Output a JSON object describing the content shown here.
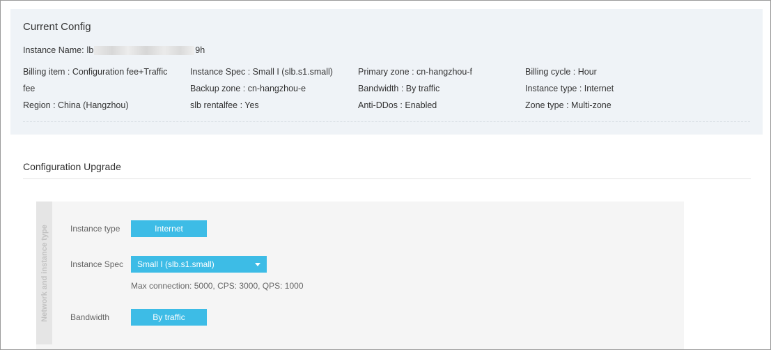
{
  "current_config": {
    "title": "Current Config",
    "instance_name_label": "Instance Name:",
    "instance_name_prefix": "lb",
    "instance_name_suffix": "9h",
    "fields": [
      {
        "text": "Billing item : Configuration fee+Traffic"
      },
      {
        "text": "fee"
      },
      {
        "text": "Region : China (Hangzhou)"
      },
      {
        "text": "Instance Spec : Small I (slb.s1.small)"
      },
      {
        "text": "Backup zone : cn-hangzhou-e"
      },
      {
        "text": "slb rentalfee : Yes"
      },
      {
        "text": "Primary zone : cn-hangzhou-f"
      },
      {
        "text": "Bandwidth : By traffic"
      },
      {
        "text": "Anti-DDos : Enabled"
      },
      {
        "text": "Billing cycle : Hour"
      },
      {
        "text": "Instance type : Internet"
      },
      {
        "text": "Zone type : Multi-zone"
      }
    ]
  },
  "upgrade": {
    "title": "Configuration Upgrade",
    "section_label": "Network and instance type",
    "instance_type": {
      "label": "Instance type",
      "value": "Internet"
    },
    "instance_spec": {
      "label": "Instance Spec",
      "value": "Small I (slb.s1.small)",
      "hint": "Max connection: 5000, CPS: 3000, QPS: 1000"
    },
    "bandwidth": {
      "label": "Bandwidth",
      "value": "By traffic"
    }
  },
  "colors": {
    "accent": "#3dbce6",
    "config_bg": "#eff3f7",
    "panel_bg": "#f5f5f5"
  }
}
